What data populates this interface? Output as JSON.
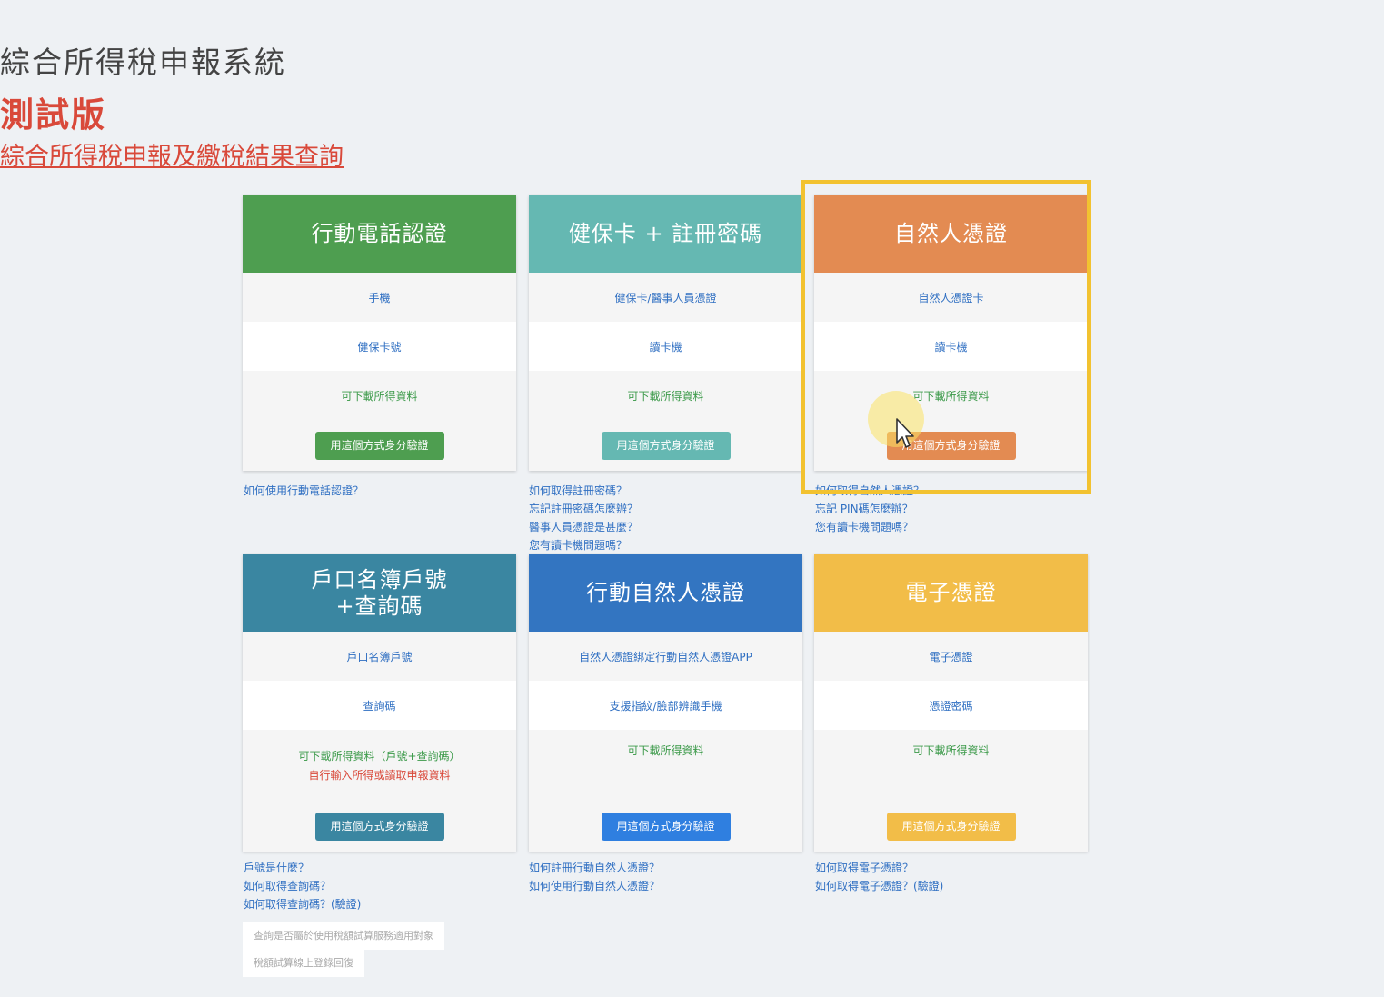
{
  "header": {
    "title": "綜合所得稅申報系統",
    "subtitle": "測試版",
    "query_link": "綜合所得稅申報及繳稅結果查詢"
  },
  "colors": {
    "green": "#4e9e50",
    "teal": "#65b8b2",
    "orange": "#e38b52",
    "darkteal": "#3a86a1",
    "blue": "#3375c1",
    "yellow": "#f2bd48",
    "highlight": "#f2c230"
  },
  "cards": [
    {
      "title": "行動電話認證",
      "rows": [
        "手機",
        "健保卡號",
        "可下載所得資料"
      ],
      "button": "用這個方式身分驗證",
      "links": [
        "如何使用行動電話認證？"
      ]
    },
    {
      "title": "健保卡 + 註冊密碼",
      "rows": [
        "健保卡/醫事人員憑證",
        "讀卡機",
        "可下載所得資料"
      ],
      "button": "用這個方式身分驗證",
      "links": [
        "如何取得註冊密碼？",
        "忘記註冊密碼怎麼辦？",
        "醫事人員憑證是甚麼？",
        "您有讀卡機問題嗎？"
      ]
    },
    {
      "title": "自然人憑證",
      "rows": [
        "自然人憑證卡",
        "讀卡機",
        "可下載所得資料"
      ],
      "button": "用這個方式身分驗證",
      "links": [
        "如何取得自然人憑證？",
        "忘記 PIN碼怎麼辦？",
        "您有讀卡機問題嗎？"
      ]
    },
    {
      "title": "戶口名簿戶號",
      "title2": "+查詢碼",
      "rows": [
        "戶口名簿戶號",
        "查詢碼",
        "可下載所得資料（戶號+查詢碼）"
      ],
      "row3_red": "自行輸入所得或讀取申報資料",
      "button": "用這個方式身分驗證",
      "links": [
        "戶號是什麼？",
        "如何取得查詢碼？",
        "如何取得查詢碼？(驗證)"
      ]
    },
    {
      "title": "行動自然人憑證",
      "rows": [
        "自然人憑證綁定行動自然人憑證APP",
        "支援指紋/臉部辨識手機",
        "可下載所得資料"
      ],
      "button": "用這個方式身分驗證",
      "links": [
        "如何註冊行動自然人憑證？",
        "如何使用行動自然人憑證？"
      ]
    },
    {
      "title": "電子憑證",
      "rows": [
        "電子憑證",
        "憑證密碼",
        "可下載所得資料"
      ],
      "button": "用這個方式身分驗證",
      "links": [
        "如何取得電子憑證？",
        "如何取得電子憑證？(驗證)"
      ]
    }
  ],
  "notices": [
    "查詢是否屬於使用稅額試算服務適用對象",
    "稅額試算線上登錄回復"
  ]
}
